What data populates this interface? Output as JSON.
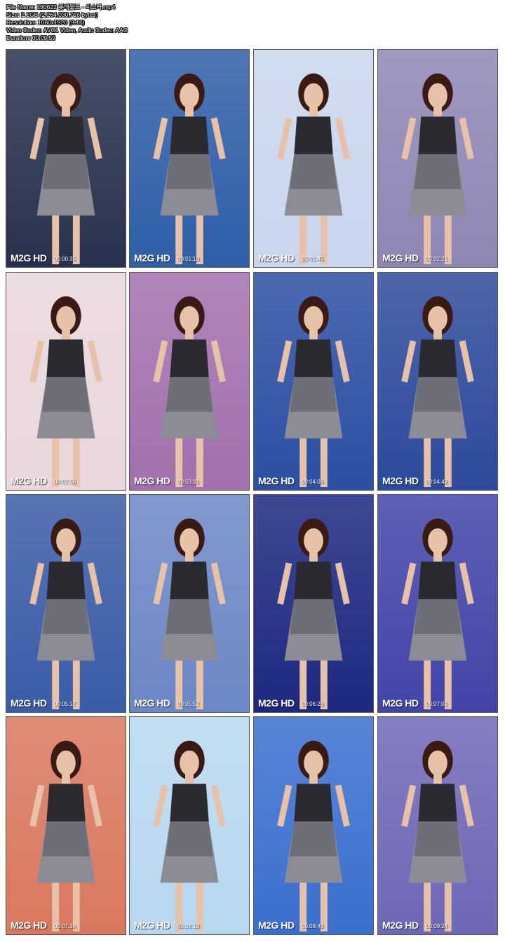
{
  "info": {
    "file_name": "File Name: 130622 롯데월드 - 씨스타.mp4",
    "size": "Size: 2.1GB (2,264,030,716 bytes)",
    "resolution": "Resolution: 1080x1920 (9:16)",
    "codec": "Video Codec: AVC1 Video, Audio Codec: AAC",
    "duration": "Duration: 00:09:59"
  },
  "logo_text": "M2G HD",
  "thumbnails": [
    {
      "timestamp": "00:00:35",
      "bg": "#28324e"
    },
    {
      "timestamp": "00:01:10",
      "bg": "#2f5ea8"
    },
    {
      "timestamp": "00:01:45",
      "bg": "#c9d6ee"
    },
    {
      "timestamp": "00:02:21",
      "bg": "#8f86b6"
    },
    {
      "timestamp": "00:02:56",
      "bg": "#e9d7dc"
    },
    {
      "timestamp": "00:03:31",
      "bg": "#a36fae"
    },
    {
      "timestamp": "00:04:06",
      "bg": "#2c4fa3"
    },
    {
      "timestamp": "00:04:42",
      "bg": "#2d4a9c"
    },
    {
      "timestamp": "00:05:17",
      "bg": "#3a5ca8"
    },
    {
      "timestamp": "00:05:52",
      "bg": "#6c87c6"
    },
    {
      "timestamp": "00:06:28",
      "bg": "#1e2880"
    },
    {
      "timestamp": "00:07:03",
      "bg": "#4244a8"
    },
    {
      "timestamp": "00:07:38",
      "bg": "#d9785f"
    },
    {
      "timestamp": "00:08:13",
      "bg": "#b7d8f0"
    },
    {
      "timestamp": "00:08:49",
      "bg": "#3b6fcf"
    },
    {
      "timestamp": "00:09:24",
      "bg": "#6e67b8"
    }
  ]
}
